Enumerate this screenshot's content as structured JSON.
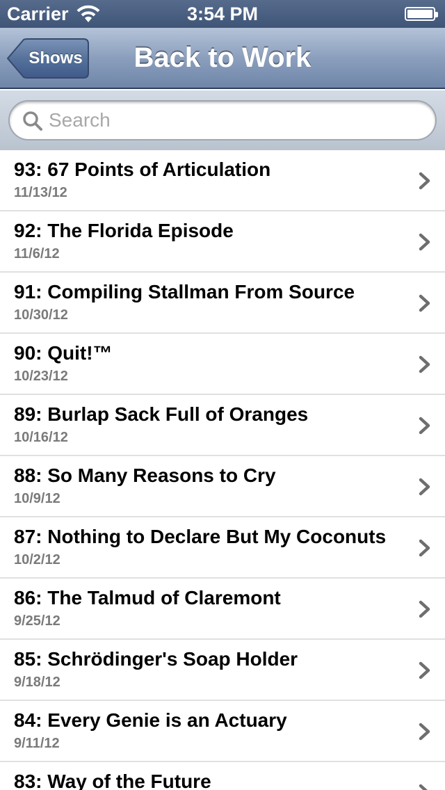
{
  "status_bar": {
    "carrier": "Carrier",
    "time": "3:54 PM"
  },
  "nav": {
    "back_label": "Shows",
    "title": "Back to Work"
  },
  "search": {
    "placeholder": "Search",
    "value": ""
  },
  "episodes": [
    {
      "title": "93: 67 Points of Articulation",
      "date": "11/13/12"
    },
    {
      "title": "92: The Florida Episode",
      "date": "11/6/12"
    },
    {
      "title": "91: Compiling Stallman From Source",
      "date": "10/30/12"
    },
    {
      "title": "90: Quit!™",
      "date": "10/23/12"
    },
    {
      "title": "89: Burlap Sack Full of Oranges",
      "date": "10/16/12"
    },
    {
      "title": "88: So Many Reasons to Cry",
      "date": "10/9/12"
    },
    {
      "title": "87: Nothing to Declare But My Coconuts",
      "date": "10/2/12"
    },
    {
      "title": "86: The Talmud of Claremont",
      "date": "9/25/12"
    },
    {
      "title": "85: Schrödinger's Soap Holder",
      "date": "9/18/12"
    },
    {
      "title": "84: Every Genie is an Actuary",
      "date": "9/11/12"
    },
    {
      "title": "83: Way of the Future",
      "date": ""
    }
  ]
}
